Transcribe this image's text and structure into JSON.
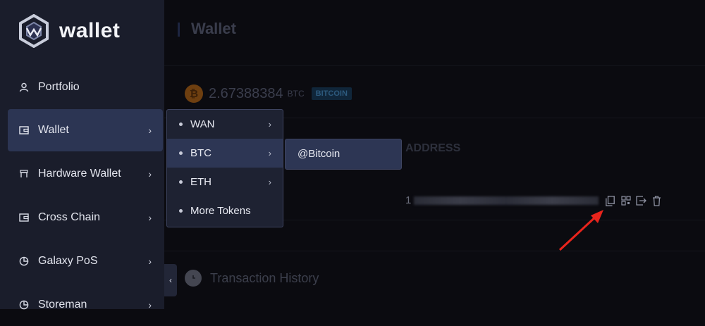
{
  "app": {
    "logo_text": "wallet",
    "logo_icon": "wanchain-hex-logo-icon"
  },
  "sidebar": {
    "items": [
      {
        "label": "Portfolio",
        "icon": "user-icon"
      },
      {
        "label": "Wallet",
        "icon": "wallet-icon",
        "active": true
      },
      {
        "label": "Hardware Wallet",
        "icon": "hardware-icon"
      },
      {
        "label": "Cross Chain",
        "icon": "cross-chain-icon"
      },
      {
        "label": "Galaxy PoS",
        "icon": "pie-chart-icon"
      },
      {
        "label": "Storeman",
        "icon": "pie-chart-icon"
      }
    ],
    "collapse_glyph": "‹"
  },
  "page": {
    "title": "Wallet"
  },
  "balance": {
    "coin_glyph": "₿",
    "amount": "2.67388384",
    "unit": "BTC",
    "badge": "BITCOIN",
    "coin_color": "#f7931a"
  },
  "address_section": {
    "header": "ADDRESS",
    "address_prefix": "1"
  },
  "actions": [
    "copy-icon",
    "qr-code-icon",
    "export-icon",
    "delete-icon"
  ],
  "transactions": {
    "title": "Transaction History"
  },
  "submenu": {
    "items": [
      {
        "label": "WAN",
        "has_children": true
      },
      {
        "label": "BTC",
        "has_children": true,
        "active": true
      },
      {
        "label": "ETH",
        "has_children": true
      },
      {
        "label": "More Tokens",
        "has_children": false
      }
    ]
  },
  "btc_submenu": {
    "items": [
      {
        "label": "@Bitcoin"
      }
    ]
  },
  "colors": {
    "sidebar_bg": "#1a1d2b",
    "active_bg": "#2c3553",
    "arrow": "#e8241c"
  }
}
